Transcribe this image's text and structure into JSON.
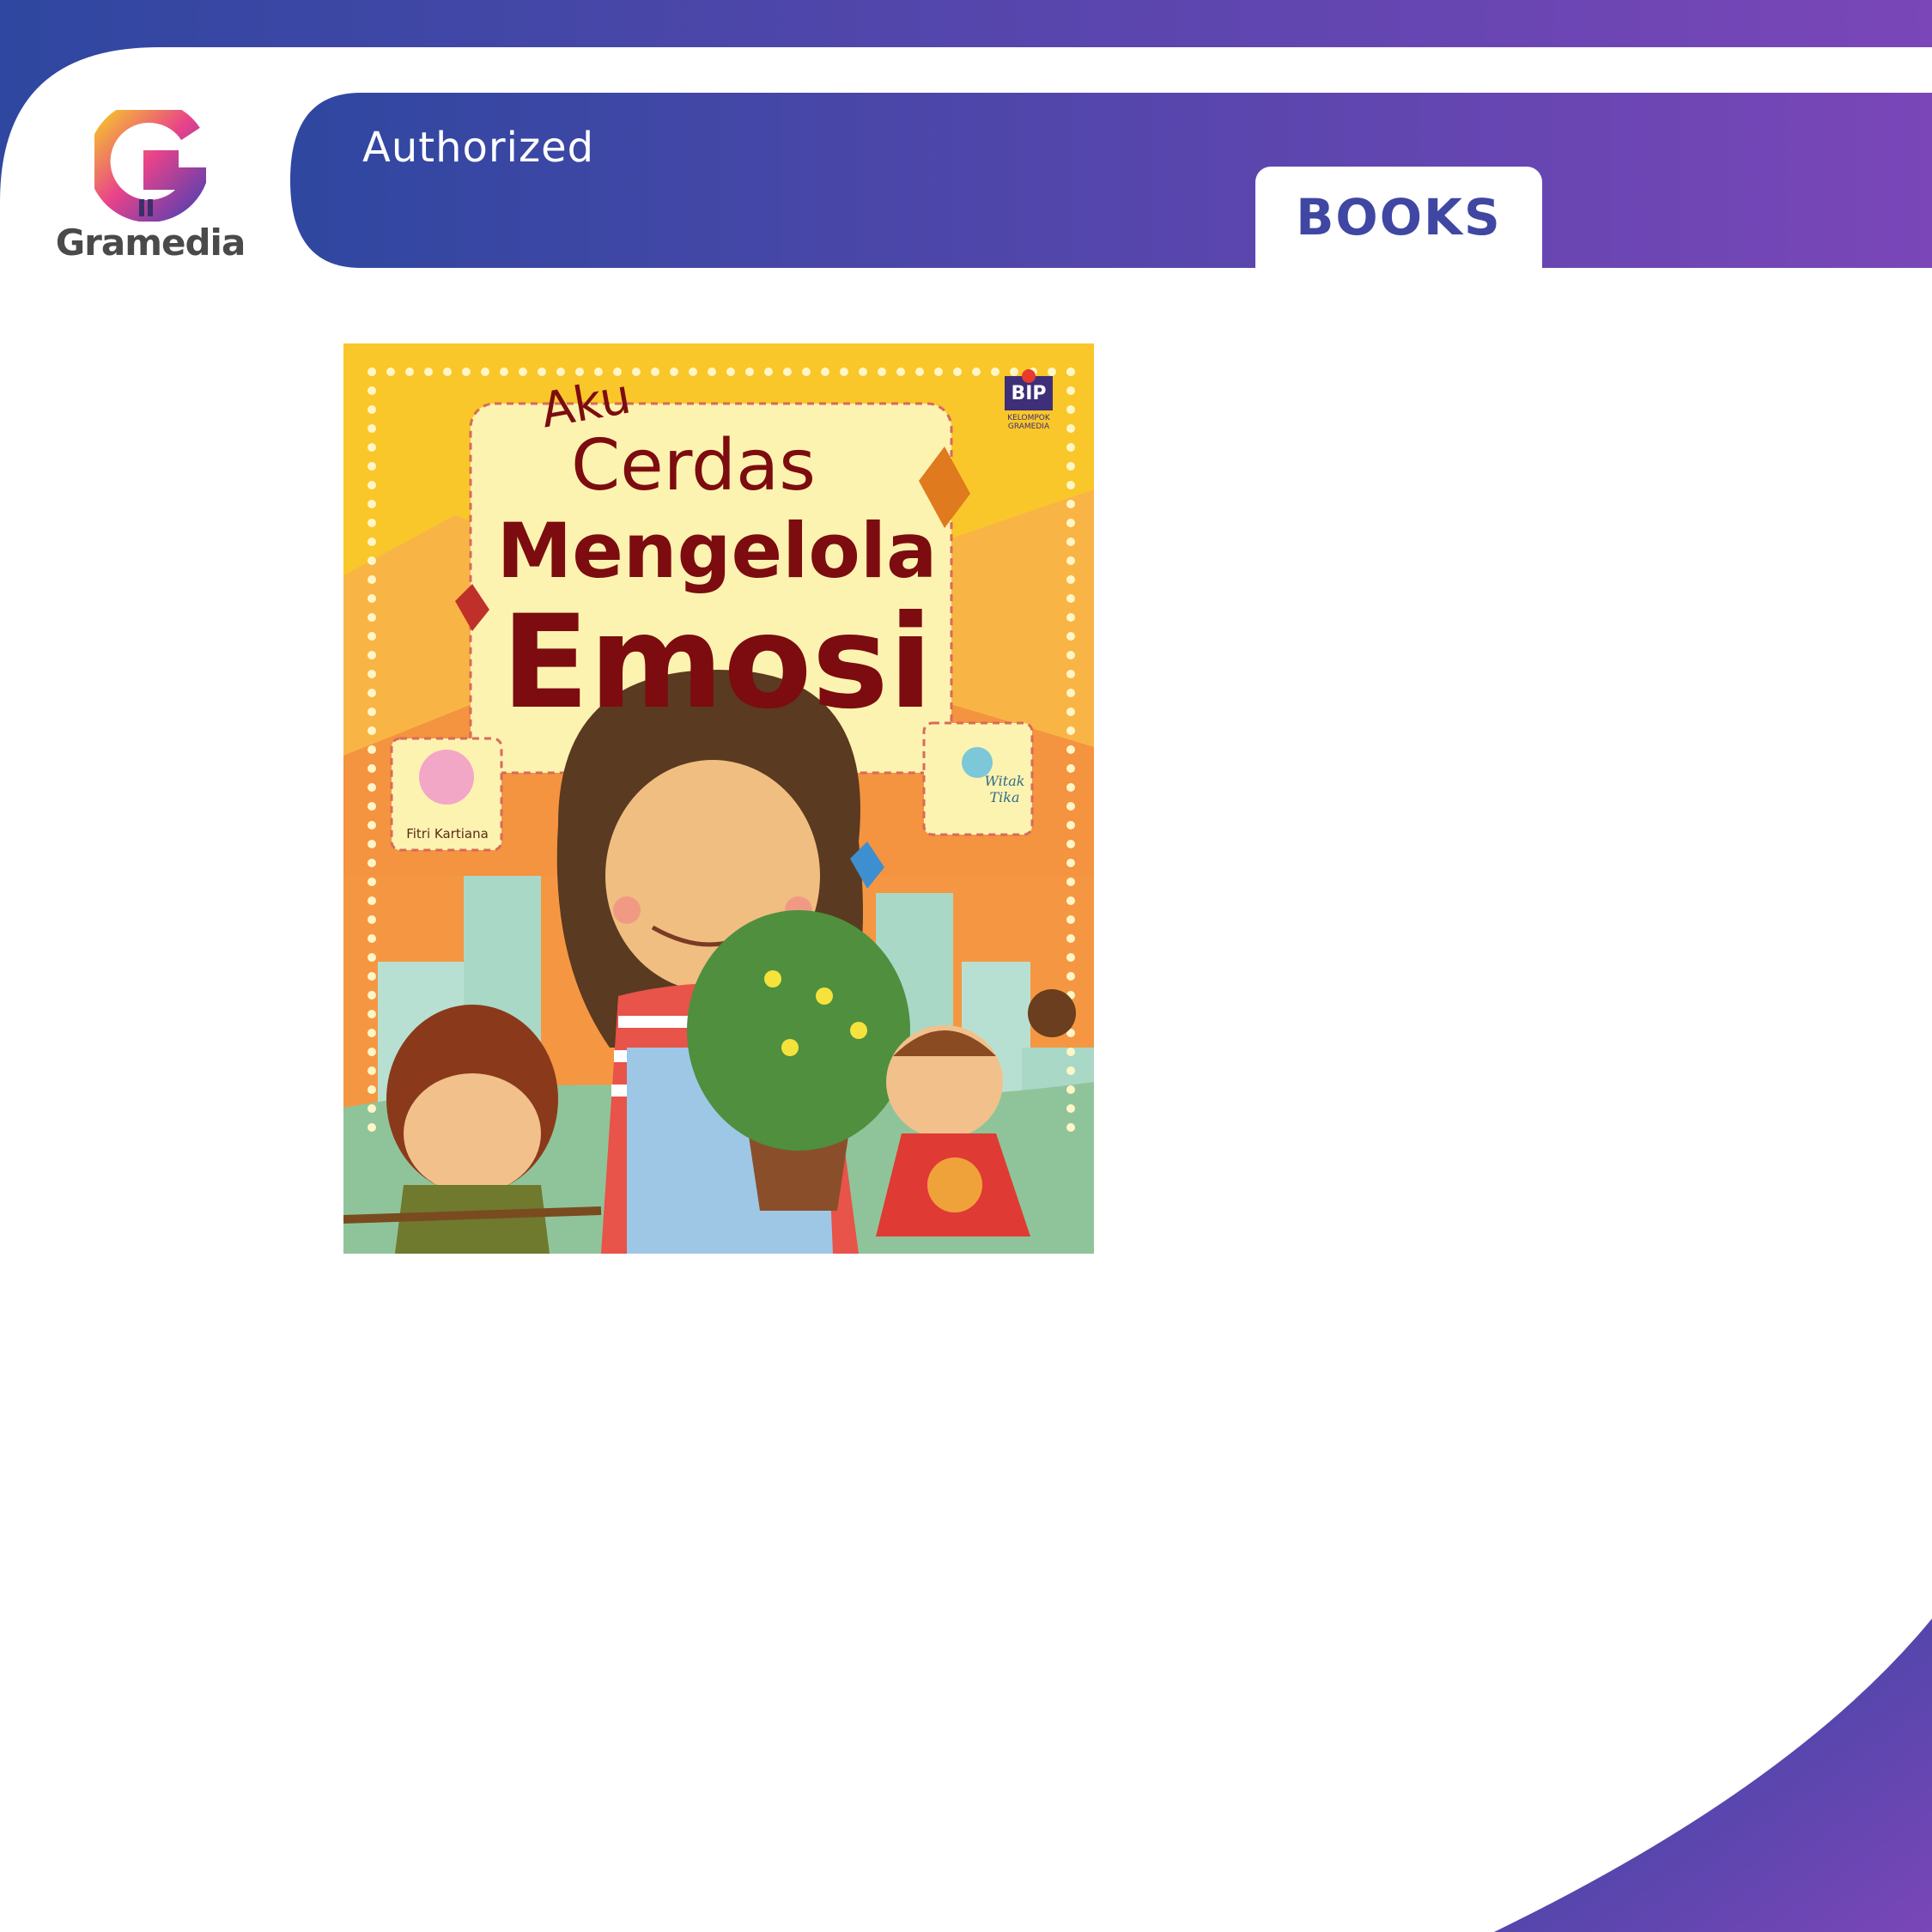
{
  "brand": {
    "name": "Gramedia",
    "logo_icon": "gramedia-g-logo-icon"
  },
  "header": {
    "label": "Authorized",
    "tab": "BOOKS"
  },
  "colors": {
    "band_start": "#2f47a0",
    "band_end": "#7a46b8",
    "tab_text": "#3f47a3",
    "cover_yellow": "#f9c72a",
    "cover_orange": "#f49340",
    "title_red": "#7c0c10"
  },
  "cover": {
    "title_line1": "Aku",
    "title_line2": "Cerdas",
    "title_line3": "Mengelola",
    "title_line4": "Emosi",
    "author": "Fitri Kartiana",
    "illustrator": "Witak Tika",
    "publisher_logo": "BIP",
    "publisher_sub": "KELOMPOK GRAMEDIA"
  }
}
